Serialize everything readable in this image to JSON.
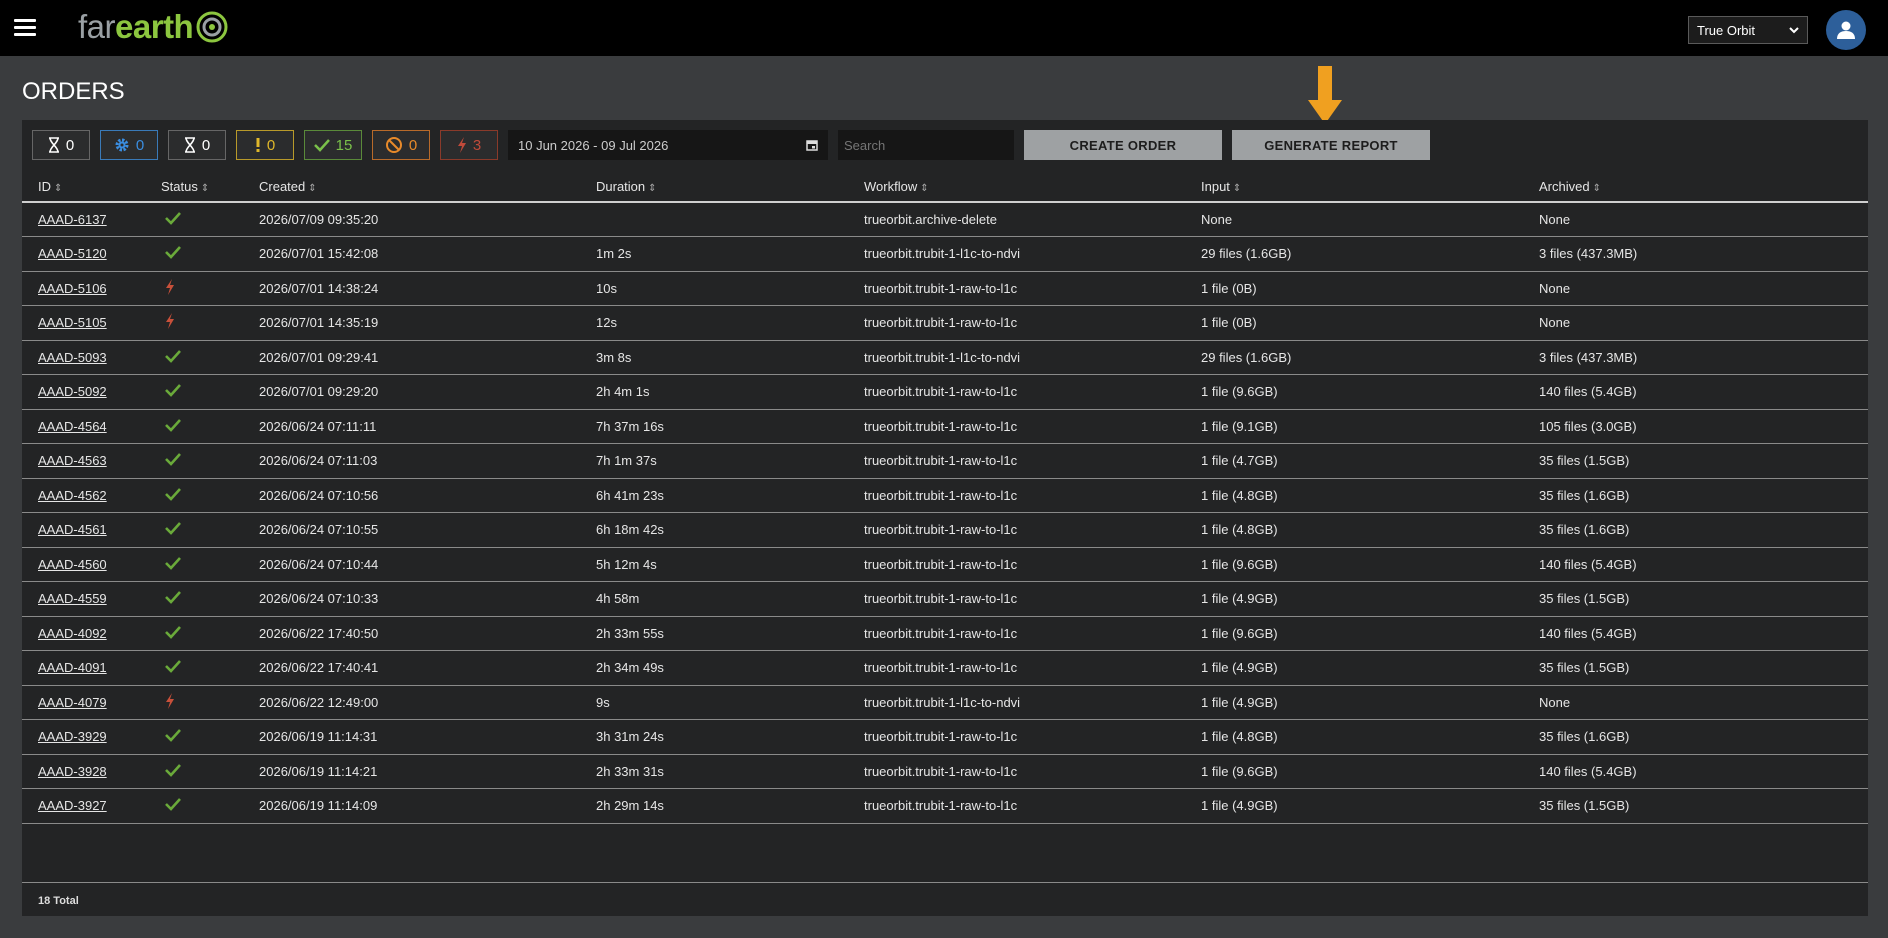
{
  "app": {
    "logo_far": "far",
    "logo_earth": "earth",
    "org_select": "True Orbit"
  },
  "page": {
    "title": "ORDERS"
  },
  "filters": {
    "chips": [
      {
        "icon": "hourglass-icon",
        "count": "0",
        "color": "#ffffff"
      },
      {
        "icon": "gear-icon",
        "count": "0",
        "color": "#3a8de0"
      },
      {
        "icon": "hourglass-icon",
        "count": "0",
        "color": "#ffffff"
      },
      {
        "icon": "exclamation-icon",
        "count": "0",
        "color": "#e0b82a"
      },
      {
        "icon": "check-icon",
        "count": "15",
        "color": "#7ac04a"
      },
      {
        "icon": "cancel-icon",
        "count": "0",
        "color": "#e88a2a"
      },
      {
        "icon": "bolt-icon",
        "count": "3",
        "color": "#c04a3a"
      }
    ],
    "date_range": "10 Jun 2026 - 09 Jul 2026",
    "search_placeholder": "Search",
    "create_label": "CREATE ORDER",
    "report_label": "GENERATE REPORT"
  },
  "table": {
    "headers": {
      "id": "ID",
      "status": "Status",
      "created": "Created",
      "duration": "Duration",
      "workflow": "Workflow",
      "input": "Input",
      "archived": "Archived"
    },
    "rows": [
      {
        "id": "AAAD-6137",
        "status": "success",
        "created": "2026/07/09 09:35:20",
        "duration": "",
        "workflow": "trueorbit.archive-delete",
        "input": "None",
        "archived": "None"
      },
      {
        "id": "AAAD-5120",
        "status": "success",
        "created": "2026/07/01 15:42:08",
        "duration": "1m 2s",
        "workflow": "trueorbit.trubit-1-l1c-to-ndvi",
        "input": "29 files (1.6GB)",
        "archived": "3 files (437.3MB)"
      },
      {
        "id": "AAAD-5106",
        "status": "failed",
        "created": "2026/07/01 14:38:24",
        "duration": "10s",
        "workflow": "trueorbit.trubit-1-raw-to-l1c",
        "input": "1 file (0B)",
        "archived": "None"
      },
      {
        "id": "AAAD-5105",
        "status": "failed",
        "created": "2026/07/01 14:35:19",
        "duration": "12s",
        "workflow": "trueorbit.trubit-1-raw-to-l1c",
        "input": "1 file (0B)",
        "archived": "None"
      },
      {
        "id": "AAAD-5093",
        "status": "success",
        "created": "2026/07/01 09:29:41",
        "duration": "3m 8s",
        "workflow": "trueorbit.trubit-1-l1c-to-ndvi",
        "input": "29 files (1.6GB)",
        "archived": "3 files (437.3MB)"
      },
      {
        "id": "AAAD-5092",
        "status": "success",
        "created": "2026/07/01 09:29:20",
        "duration": "2h 4m 1s",
        "workflow": "trueorbit.trubit-1-raw-to-l1c",
        "input": "1 file (9.6GB)",
        "archived": "140 files (5.4GB)"
      },
      {
        "id": "AAAD-4564",
        "status": "success",
        "created": "2026/06/24 07:11:11",
        "duration": "7h 37m 16s",
        "workflow": "trueorbit.trubit-1-raw-to-l1c",
        "input": "1 file (9.1GB)",
        "archived": "105 files (3.0GB)"
      },
      {
        "id": "AAAD-4563",
        "status": "success",
        "created": "2026/06/24 07:11:03",
        "duration": "7h 1m 37s",
        "workflow": "trueorbit.trubit-1-raw-to-l1c",
        "input": "1 file (4.7GB)",
        "archived": "35 files (1.5GB)"
      },
      {
        "id": "AAAD-4562",
        "status": "success",
        "created": "2026/06/24 07:10:56",
        "duration": "6h 41m 23s",
        "workflow": "trueorbit.trubit-1-raw-to-l1c",
        "input": "1 file (4.8GB)",
        "archived": "35 files (1.6GB)"
      },
      {
        "id": "AAAD-4561",
        "status": "success",
        "created": "2026/06/24 07:10:55",
        "duration": "6h 18m 42s",
        "workflow": "trueorbit.trubit-1-raw-to-l1c",
        "input": "1 file (4.8GB)",
        "archived": "35 files (1.6GB)"
      },
      {
        "id": "AAAD-4560",
        "status": "success",
        "created": "2026/06/24 07:10:44",
        "duration": "5h 12m 4s",
        "workflow": "trueorbit.trubit-1-raw-to-l1c",
        "input": "1 file (9.6GB)",
        "archived": "140 files (5.4GB)"
      },
      {
        "id": "AAAD-4559",
        "status": "success",
        "created": "2026/06/24 07:10:33",
        "duration": "4h 58m",
        "workflow": "trueorbit.trubit-1-raw-to-l1c",
        "input": "1 file (4.9GB)",
        "archived": "35 files (1.5GB)"
      },
      {
        "id": "AAAD-4092",
        "status": "success",
        "created": "2026/06/22 17:40:50",
        "duration": "2h 33m 55s",
        "workflow": "trueorbit.trubit-1-raw-to-l1c",
        "input": "1 file (9.6GB)",
        "archived": "140 files (5.4GB)"
      },
      {
        "id": "AAAD-4091",
        "status": "success",
        "created": "2026/06/22 17:40:41",
        "duration": "2h 34m 49s",
        "workflow": "trueorbit.trubit-1-raw-to-l1c",
        "input": "1 file (4.9GB)",
        "archived": "35 files (1.5GB)"
      },
      {
        "id": "AAAD-4079",
        "status": "failed",
        "created": "2026/06/22 12:49:00",
        "duration": "9s",
        "workflow": "trueorbit.trubit-1-l1c-to-ndvi",
        "input": "1 file (4.9GB)",
        "archived": "None"
      },
      {
        "id": "AAAD-3929",
        "status": "success",
        "created": "2026/06/19 11:14:31",
        "duration": "3h 31m 24s",
        "workflow": "trueorbit.trubit-1-raw-to-l1c",
        "input": "1 file (4.8GB)",
        "archived": "35 files (1.6GB)"
      },
      {
        "id": "AAAD-3928",
        "status": "success",
        "created": "2026/06/19 11:14:21",
        "duration": "2h 33m 31s",
        "workflow": "trueorbit.trubit-1-raw-to-l1c",
        "input": "1 file (9.6GB)",
        "archived": "140 files (5.4GB)"
      },
      {
        "id": "AAAD-3927",
        "status": "success",
        "created": "2026/06/19 11:14:09",
        "duration": "2h 29m 14s",
        "workflow": "trueorbit.trubit-1-raw-to-l1c",
        "input": "1 file (4.9GB)",
        "archived": "35 files (1.5GB)"
      }
    ],
    "total": "18 Total"
  },
  "colors": {
    "success": "#6aaa3a",
    "failed": "#c8503a",
    "annotation_arrow": "#f0a020"
  }
}
